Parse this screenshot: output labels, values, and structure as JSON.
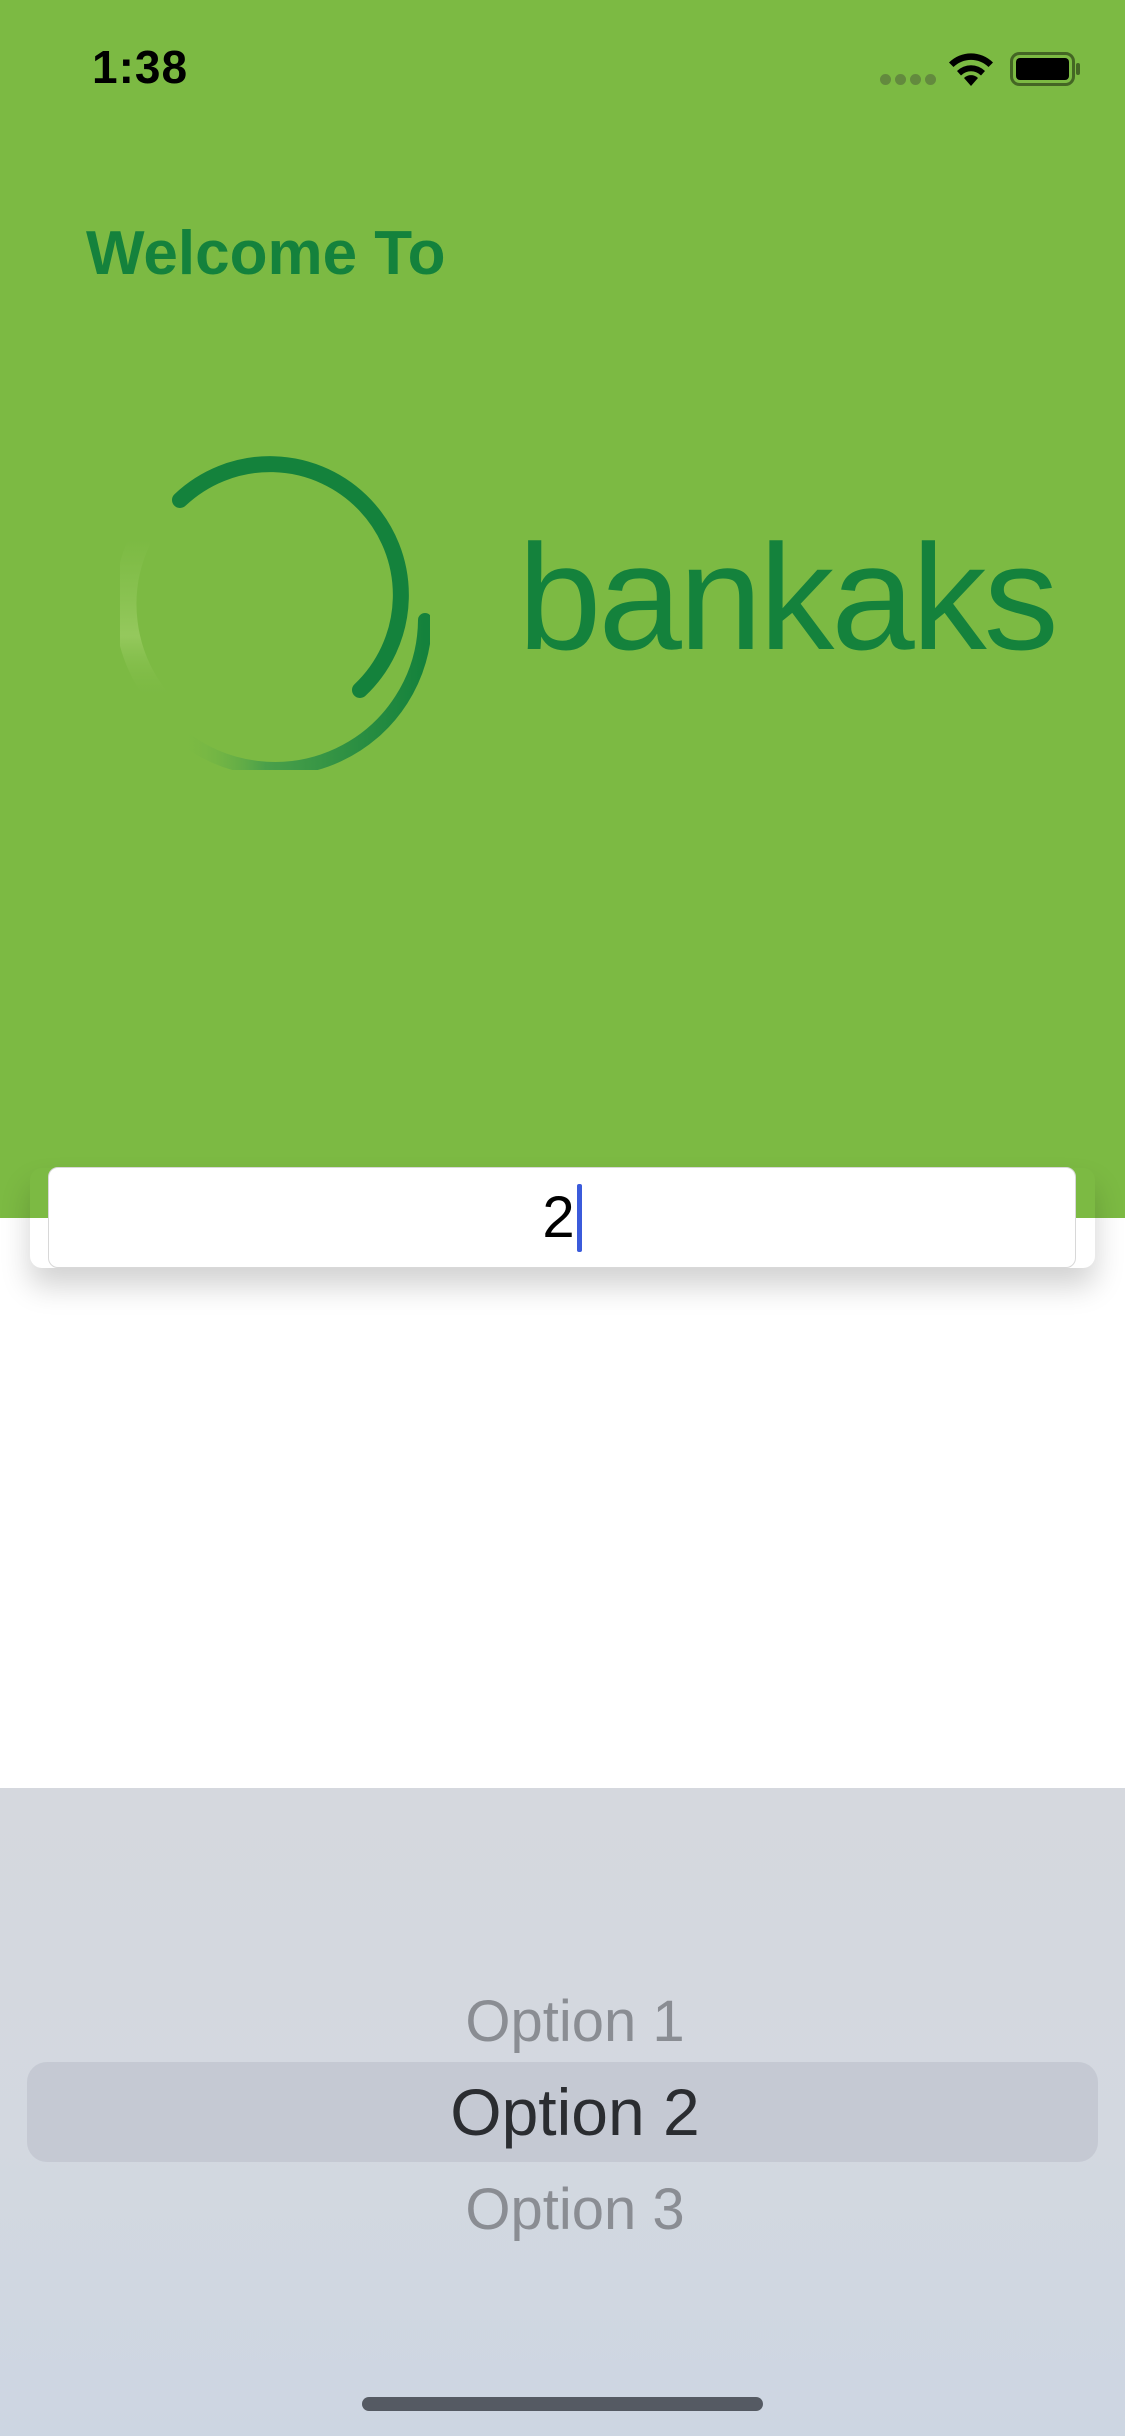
{
  "status_bar": {
    "time": "1:38",
    "icons": [
      "signal-dots-icon",
      "wifi-icon",
      "battery-icon"
    ]
  },
  "header": {
    "welcome_title": "Welcome To",
    "brand_name": "bankaks",
    "background_color": "#7cba43",
    "brand_color": "#14823c"
  },
  "option_field": {
    "value": "2"
  },
  "picker": {
    "options": [
      "Option 1",
      "Option 2",
      "Option 3"
    ],
    "selected": "Option 2"
  }
}
